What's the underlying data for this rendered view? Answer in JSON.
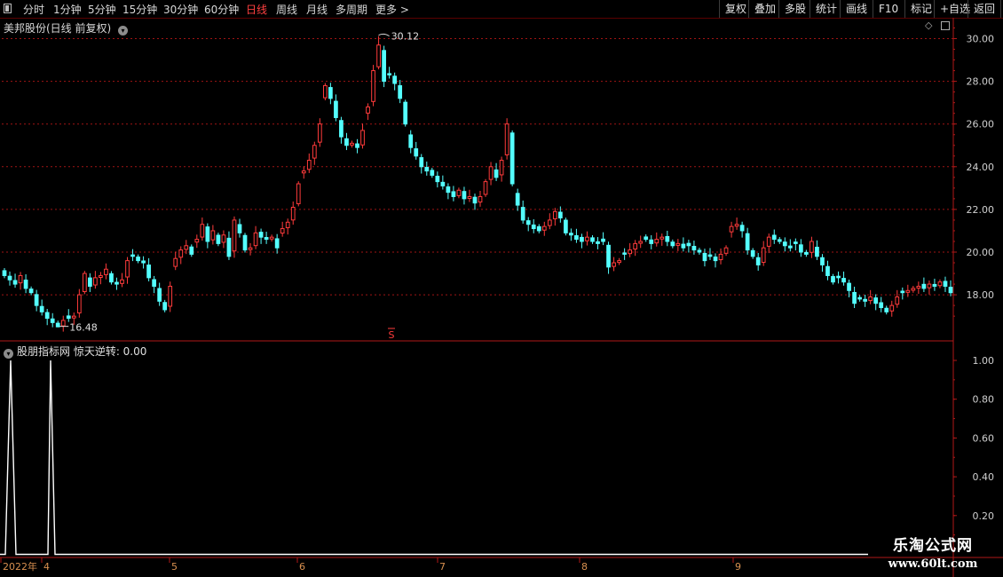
{
  "toolbar": {
    "periods": [
      "分时",
      "1分钟",
      "5分钟",
      "15分钟",
      "30分钟",
      "60分钟",
      "日线",
      "周线",
      "月线",
      "多周期",
      "更多 >"
    ],
    "active_period": "日线",
    "right_buttons": [
      "复权",
      "叠加",
      "多股",
      "统计",
      "画线",
      "F10",
      "标记",
      "+自选",
      "返回"
    ]
  },
  "main_panel": {
    "title": "美邦股份(日线 前复权)",
    "high_label": "30.12",
    "low_label": "16.48",
    "marker": "S"
  },
  "indicator_panel": {
    "title": "股朋指标网  惊天逆转: 0.00"
  },
  "watermark": {
    "line1": "乐淘公式网",
    "line2": "www.60lt.com"
  },
  "colors": {
    "up": "#ff3b3b",
    "down": "#54ffff",
    "axis": "#b01818",
    "grid": "#a01414",
    "indicator_line": "#ffffff"
  },
  "chart_data": [
    {
      "type": "candlestick",
      "title": "美邦股份(日线 前复权)",
      "y_ticks": [
        "30.00",
        "28.00",
        "26.00",
        "24.00",
        "22.00",
        "20.00",
        "18.00"
      ],
      "ylim": [
        16.0,
        30.5
      ],
      "x_labels": [
        "2022年",
        "4",
        "5",
        "6",
        "7",
        "8",
        "9"
      ],
      "annotations": [
        {
          "label": "30.12",
          "type": "high"
        },
        {
          "label": "16.48",
          "type": "low"
        }
      ],
      "close_series_approx": [
        18.9,
        18.7,
        18.5,
        18.9,
        18.3,
        18.1,
        17.5,
        17.2,
        16.9,
        16.7,
        16.5,
        16.8,
        16.9,
        17.0,
        18.0,
        19.0,
        18.4,
        18.8,
        18.9,
        19.2,
        18.6,
        18.5,
        18.7,
        19.6,
        19.8,
        19.6,
        19.5,
        18.8,
        18.4,
        17.7,
        17.3,
        18.4,
        19.7,
        20.1,
        20.3,
        19.9,
        20.6,
        21.3,
        20.5,
        21.0,
        20.4,
        20.8,
        19.8,
        21.5,
        20.9,
        20.1,
        20.2,
        20.9,
        20.7,
        20.6,
        20.7,
        20.2,
        21.1,
        21.4,
        22.1,
        23.2,
        23.8,
        24.3,
        25.0,
        26.0,
        27.8,
        27.2,
        26.3,
        25.4,
        25.0,
        25.1,
        24.9,
        25.7,
        26.8,
        28.5,
        29.7,
        28.0,
        28.3,
        27.9,
        27.2,
        26.0,
        24.9,
        24.5,
        24.0,
        23.8,
        23.6,
        23.3,
        23.1,
        22.8,
        22.6,
        22.9,
        22.5,
        22.6,
        22.3,
        22.6,
        23.3,
        24.0,
        23.5,
        24.3,
        26.0,
        23.2,
        22.2,
        21.5,
        21.3,
        21.1,
        21.0,
        21.2,
        21.5,
        21.9,
        21.6,
        20.9,
        20.8,
        20.6,
        20.5,
        20.7,
        20.5,
        20.4,
        20.5,
        19.3,
        19.5,
        19.6,
        19.9,
        20.1,
        20.4,
        20.5,
        20.6,
        20.4,
        20.6,
        20.7,
        20.5,
        20.3,
        20.4,
        20.2,
        20.3,
        20.1,
        20.0,
        19.6,
        19.8,
        19.6,
        19.9,
        20.2,
        21.2,
        21.3,
        21.0,
        20.1,
        19.8,
        19.4,
        20.2,
        20.7,
        20.6,
        20.5,
        20.3,
        20.2,
        20.4,
        20.0,
        19.9,
        20.5,
        19.8,
        19.4,
        18.9,
        18.6,
        18.8,
        18.6,
        18.2,
        17.6,
        17.8,
        17.7,
        17.9,
        17.6,
        17.4,
        17.2,
        17.5,
        17.9,
        18.1,
        18.2,
        18.3,
        18.4,
        18.3,
        18.5,
        18.4,
        18.6,
        18.4,
        18.1
      ]
    },
    {
      "type": "line",
      "title": "股朋指标网  惊天逆转: 0.00",
      "series": [
        {
          "name": "惊天逆转",
          "points": [
            [
              0,
              0
            ],
            [
              1,
              0
            ],
            [
              2,
              1
            ],
            [
              3,
              0
            ],
            [
              4,
              0
            ],
            [
              5,
              0
            ],
            [
              6,
              0
            ],
            [
              7,
              0
            ],
            [
              8,
              0
            ],
            [
              9,
              0
            ],
            [
              10,
              0
            ],
            [
              11,
              1
            ],
            [
              12,
              0
            ],
            [
              13,
              0
            ],
            [
              14,
              0
            ],
            [
              15,
              0
            ],
            [
              16,
              0
            ],
            [
              17,
              0
            ],
            [
              18,
              0
            ],
            [
              19,
              0
            ]
          ]
        }
      ],
      "y_ticks": [
        "1.00",
        "0.80",
        "0.60",
        "0.40",
        "0.20"
      ],
      "ylim": [
        0,
        1.1
      ]
    }
  ]
}
